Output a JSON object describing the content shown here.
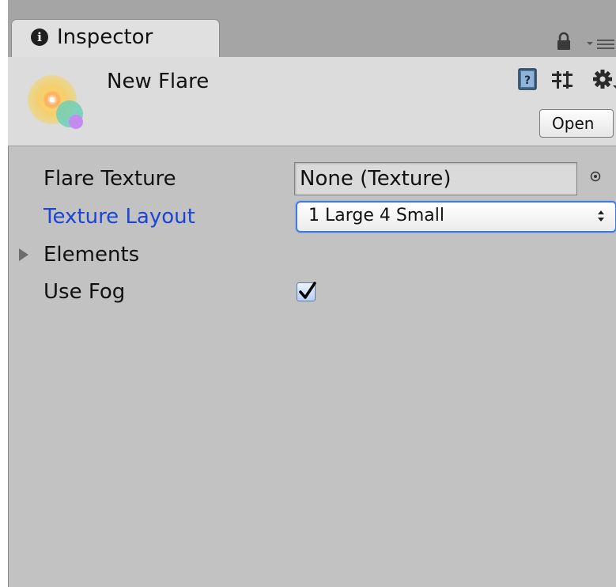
{
  "tab": {
    "label": "Inspector",
    "info_icon": "i"
  },
  "header": {
    "asset_name": "New Flare",
    "open_label": "Open",
    "icons": [
      "flare-asset-icon",
      "help-book-icon",
      "preset-icon",
      "gear-icon"
    ]
  },
  "properties": {
    "flare_texture": {
      "label": "Flare Texture",
      "value": "None (Texture)"
    },
    "texture_layout": {
      "label": "Texture Layout",
      "value": "1 Large 4 Small"
    },
    "elements": {
      "label": "Elements",
      "expanded": false
    },
    "use_fog": {
      "label": "Use Fog",
      "checked": true
    }
  },
  "colors": {
    "focused_label": "#1a45d6",
    "panel_bg": "#c2c2c2",
    "header_bg": "#dcdcdc",
    "tabbar_bg": "#a5a5a5"
  }
}
